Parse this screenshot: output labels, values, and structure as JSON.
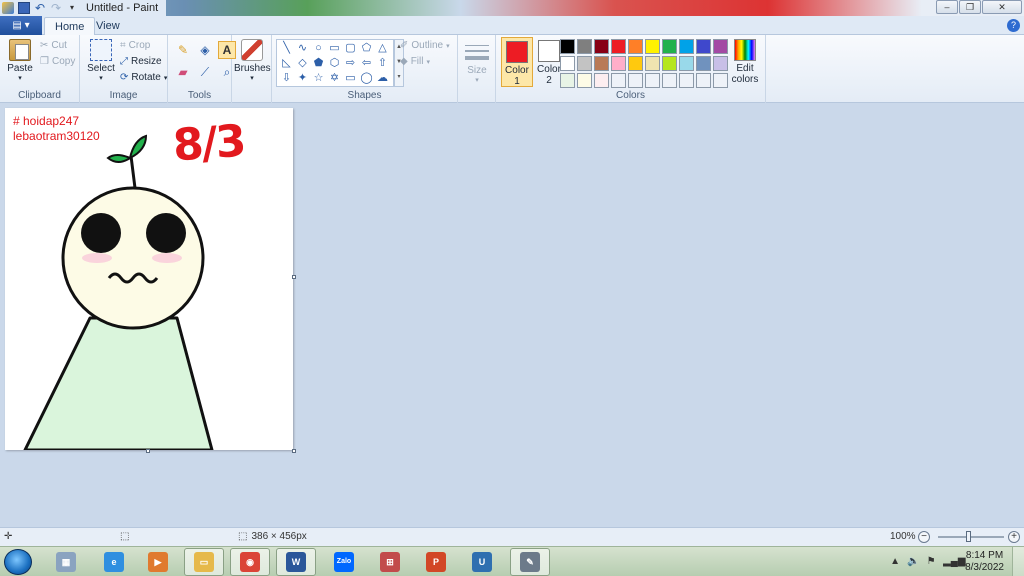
{
  "window": {
    "title": "Untitled - Paint"
  },
  "tabs": {
    "file": "▤ ▾",
    "home": "Home",
    "view": "View"
  },
  "clipboard": {
    "paste": "Paste",
    "cut": "Cut",
    "copy": "Copy",
    "label": "Clipboard"
  },
  "image": {
    "select": "Select",
    "crop": "Crop",
    "resize": "Resize",
    "rotate": "Rotate",
    "label": "Image"
  },
  "tools": {
    "label": "Tools"
  },
  "brushes": {
    "label": "Brushes"
  },
  "shapes": {
    "outline": "Outline",
    "fill": "Fill",
    "label": "Shapes"
  },
  "size": {
    "label": "Size"
  },
  "colors": {
    "color1_label": "Color",
    "color1_num": "1",
    "color2_label": "Color",
    "color2_num": "2",
    "edit_label": "Edit",
    "edit_label2": "colors",
    "label": "Colors",
    "color1_value": "#ed1c24",
    "color2_value": "#ffffff",
    "palette": [
      "#000000",
      "#7f7f7f",
      "#880015",
      "#ed1c24",
      "#ff7f27",
      "#fff200",
      "#22b14c",
      "#00a2e8",
      "#3f48cc",
      "#a349a4",
      "#ffffff",
      "#c3c3c3",
      "#b97a57",
      "#ffaec9",
      "#ffc90e",
      "#efe4b0",
      "#b5e61d",
      "#99d9ea",
      "#7092be",
      "#c8bfe7",
      "#e8f4e6",
      "#fdfbe6",
      "#fdeef0",
      "#eef2f8",
      "#eef2f8",
      "#eef2f8",
      "#eef2f8",
      "#eef2f8",
      "#eef2f8",
      "#eef2f8"
    ]
  },
  "canvas": {
    "hashtag": "# hoidap247",
    "author": "lebaotram30120",
    "date": "8/3"
  },
  "status": {
    "dimensions": "386 × 456px",
    "zoom": "100%"
  },
  "clock": {
    "time": "8:14 PM",
    "date": "8/3/2022"
  },
  "taskbar": {
    "apps": [
      {
        "name": "calculator",
        "glyph": "▦",
        "color": "#8aa3c0"
      },
      {
        "name": "internet-explorer",
        "glyph": "e",
        "color": "#2f8fe0"
      },
      {
        "name": "media-player",
        "glyph": "▶",
        "color": "#e07a2f"
      },
      {
        "name": "file-explorer",
        "glyph": "▭",
        "color": "#e6b94a"
      },
      {
        "name": "chrome",
        "glyph": "◉",
        "color": "#db4437"
      },
      {
        "name": "word",
        "glyph": "W",
        "color": "#2b579a"
      },
      {
        "name": "zalo",
        "glyph": "Zalo",
        "color": "#0068ff"
      },
      {
        "name": "network-app",
        "glyph": "⊞",
        "color": "#c24b4b"
      },
      {
        "name": "powerpoint",
        "glyph": "P",
        "color": "#d24726"
      },
      {
        "name": "ultraviewer",
        "glyph": "U",
        "color": "#2f6fb0"
      },
      {
        "name": "paint",
        "glyph": "✎",
        "color": "#6c7a8a"
      }
    ]
  }
}
